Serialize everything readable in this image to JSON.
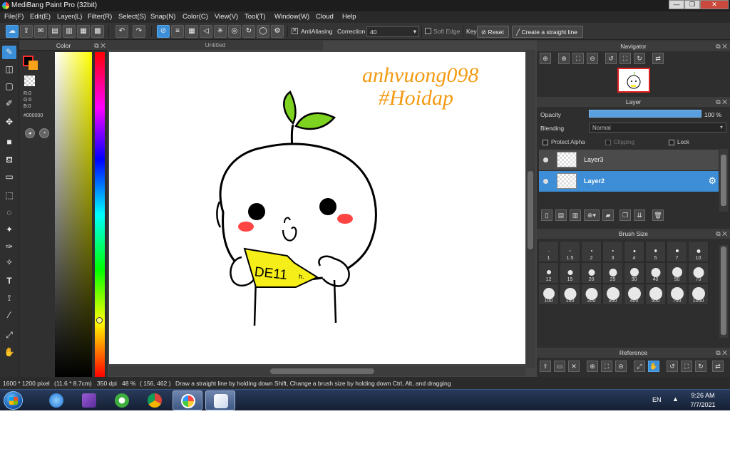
{
  "window": {
    "title": "MediBang Paint Pro (32bit)",
    "controls": [
      "—",
      "❐",
      "✕"
    ]
  },
  "menu": [
    "File(F)",
    "Edit(E)",
    "Layer(L)",
    "Filter(R)",
    "Select(S)",
    "Snap(N)",
    "Color(C)",
    "View(V)",
    "Tool(T)",
    "Window(W)",
    "Cloud",
    "Help"
  ],
  "toolbar": {
    "antialiasing_label": "AntiAliasing",
    "antialiasing_checked": true,
    "correction_label": "Correction",
    "correction_value": "40",
    "soft_edge_label": "Soft Edge",
    "key_label": "Key",
    "reset_label": "Reset",
    "create_line_label": "Create a straight line"
  },
  "color_panel": {
    "title": "Color",
    "r": "R:0",
    "g": "G:0",
    "b": "B:0",
    "hex": "#000000",
    "fg_color": "#000000",
    "bg_color": "#f9a21a"
  },
  "document": {
    "tab_title": "Untitled",
    "watermark_line1": "anhvuong098",
    "watermark_line2": "#Hoidap",
    "sign_text": "DE11"
  },
  "navigator": {
    "title": "Navigator"
  },
  "layer_panel": {
    "title": "Layer",
    "opacity_label": "Opacity",
    "opacity_value": "100 %",
    "opacity_fraction": 1.0,
    "blending_label": "Blending",
    "blending_value": "Normal",
    "protect_alpha": "Protect Alpha",
    "clipping": "Clipping",
    "lock": "Lock",
    "layers": [
      {
        "name": "Layer3",
        "selected": false
      },
      {
        "name": "Layer2",
        "selected": true
      }
    ]
  },
  "brush_size": {
    "title": "Brush Size",
    "sizes": [
      "1",
      "1.5",
      "2",
      "3",
      "4",
      "5",
      "7",
      "10",
      "12",
      "15",
      "20",
      "25",
      "30",
      "40",
      "50",
      "70",
      "100",
      "150",
      "200",
      "300",
      "400",
      "500",
      "700",
      "1000"
    ]
  },
  "reference": {
    "title": "Reference"
  },
  "status": {
    "dimensions": "1600 * 1200 pixel",
    "physical": "(11.6 * 8.7cm)",
    "dpi": "350 dpi",
    "zoom": "48 %",
    "coords": "( 156, 462 )",
    "hint": "Draw a straight line by holding down Shift, Change a brush size by holding down Ctrl, Alt, and dragging"
  },
  "taskbar": {
    "lang": "EN",
    "time": "9:26 AM",
    "date": "7/7/2021"
  },
  "colors": {
    "accent": "#3a8fd8",
    "panel_bg": "#2e2e2e",
    "watermark": "#f39a12"
  }
}
